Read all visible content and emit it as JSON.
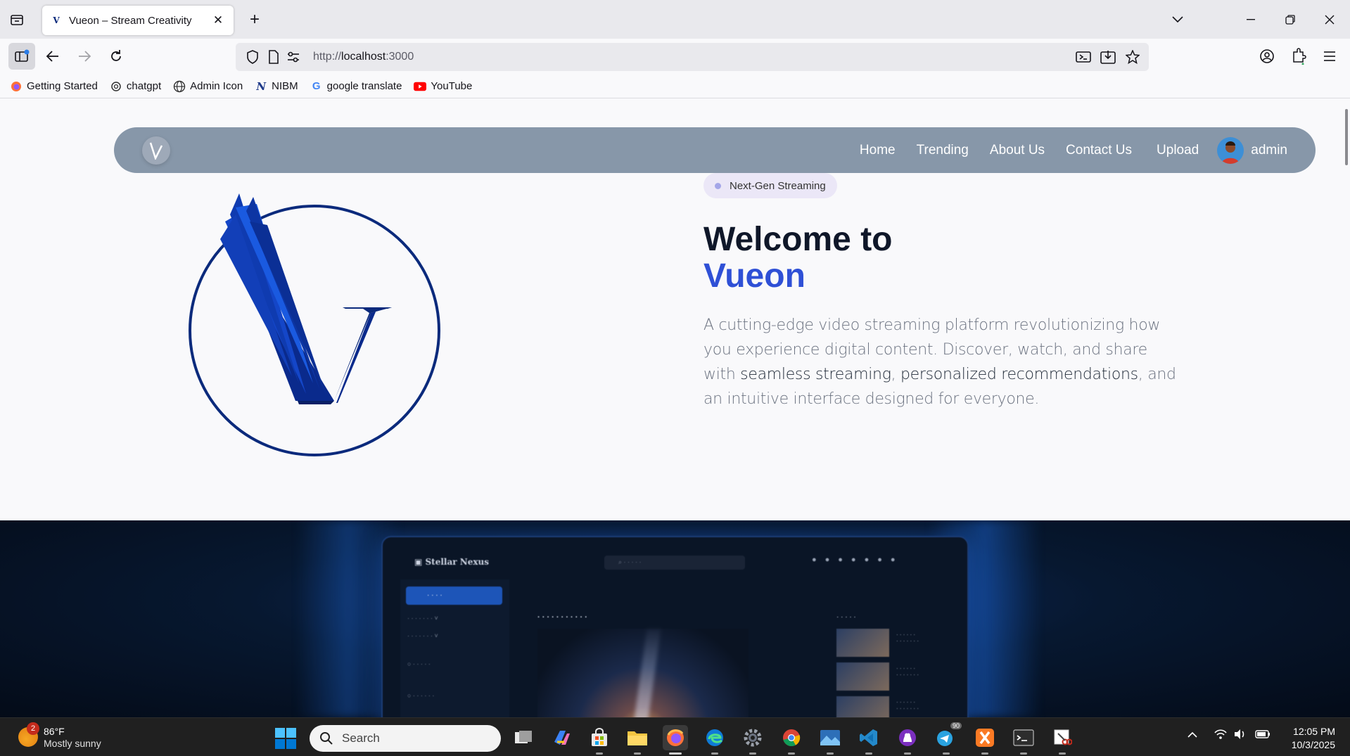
{
  "browser": {
    "tab_title": "Vueon – Stream Creativity",
    "tab_favicon": "V",
    "url_prefix": "http://",
    "url_host": "localhost",
    "url_port": ":3000",
    "bookmarks": [
      {
        "label": "Getting Started",
        "icon": "firefox-icon"
      },
      {
        "label": "chatgpt",
        "icon": "openai-icon"
      },
      {
        "label": "Admin Icon",
        "icon": "globe-icon"
      },
      {
        "label": "NIBM",
        "icon": "nibm-icon"
      },
      {
        "label": "google translate",
        "icon": "google-icon"
      },
      {
        "label": "YouTube",
        "icon": "youtube-icon"
      }
    ]
  },
  "site": {
    "nav": {
      "home": "Home",
      "trending": "Trending",
      "about": "About Us",
      "contact": "Contact Us",
      "upload": "Upload",
      "user": "admin"
    },
    "badge": "Next-Gen Streaming",
    "title_line1": "Welcome to",
    "title_line2": "Vueon",
    "desc_part1": "A cutting-edge video streaming platform revolutionizing how you experience digital content. Discover, watch, and share with ",
    "desc_strong1": "seamless streaming",
    "desc_part2": ", ",
    "desc_strong2": "personalized recommendations",
    "desc_part3": ", and an intuitive interface designed for everyone.",
    "colors": {
      "accent": "#2f50d6",
      "nav_bg": "#8797a9",
      "logo_blue": "#0b2a7c"
    }
  },
  "taskbar": {
    "weather_temp": "86°F",
    "weather_desc": "Mostly sunny",
    "weather_badge": "2",
    "search_placeholder": "Search",
    "time": "12:05 PM",
    "date": "10/3/2025",
    "telegram_badge": "90"
  }
}
